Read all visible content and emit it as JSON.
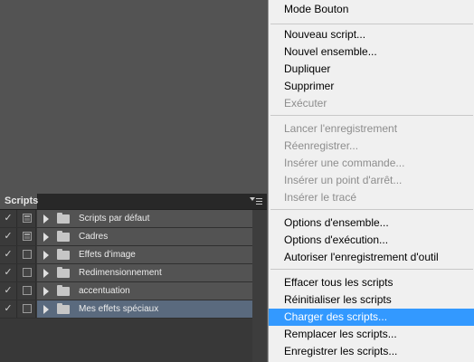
{
  "panel": {
    "tab_label": "Scripts",
    "rows": [
      {
        "label": "Scripts par défaut",
        "checked": "✓",
        "dialog": "filled",
        "selected": false
      },
      {
        "label": "Cadres",
        "checked": "✓",
        "dialog": "filled",
        "selected": false
      },
      {
        "label": "Effets d'image",
        "checked": "✓",
        "dialog": "empty",
        "selected": false
      },
      {
        "label": "Redimensionnement",
        "checked": "✓",
        "dialog": "empty",
        "selected": false
      },
      {
        "label": "accentuation",
        "checked": "✓",
        "dialog": "empty",
        "selected": false
      },
      {
        "label": "Mes effets spéciaux",
        "checked": "✓",
        "dialog": "empty",
        "selected": true
      }
    ]
  },
  "menu": {
    "items": [
      {
        "label": "Mode Bouton",
        "disabled": false
      },
      {
        "label": "Nouveau script...",
        "disabled": false
      },
      {
        "label": "Nouvel ensemble...",
        "disabled": false
      },
      {
        "label": "Dupliquer",
        "disabled": false
      },
      {
        "label": "Supprimer",
        "disabled": false
      },
      {
        "label": "Exécuter",
        "disabled": true
      },
      {
        "label": "Lancer l'enregistrement",
        "disabled": true
      },
      {
        "label": "Réenregistrer...",
        "disabled": true
      },
      {
        "label": "Insérer une commande...",
        "disabled": true
      },
      {
        "label": "Insérer un point d'arrêt...",
        "disabled": true
      },
      {
        "label": "Insérer le tracé",
        "disabled": true
      },
      {
        "label": "Options d'ensemble...",
        "disabled": false
      },
      {
        "label": "Options d'exécution...",
        "disabled": false
      },
      {
        "label": "Autoriser l'enregistrement d'outil",
        "disabled": false
      },
      {
        "label": "Effacer tous les scripts",
        "disabled": false
      },
      {
        "label": "Réinitialiser les scripts",
        "disabled": false
      },
      {
        "label": "Charger des scripts...",
        "disabled": false,
        "highlighted": true
      },
      {
        "label": "Remplacer les scripts...",
        "disabled": false
      },
      {
        "label": "Enregistrer les scripts...",
        "disabled": false
      }
    ],
    "highlight_color": "#3399ff"
  }
}
